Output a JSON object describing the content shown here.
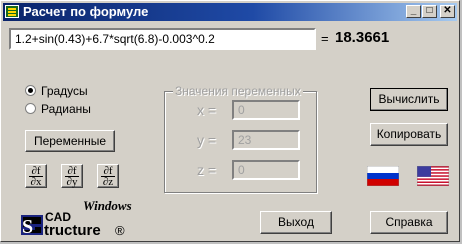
{
  "window": {
    "title": "Расчет по формуле",
    "min_label": "_",
    "max_label": "□",
    "close_label": "✕"
  },
  "formula": {
    "expression": "1.2+sin(0.43)+6.7*sqrt(6.8)-0.003^0.2",
    "equals": "=",
    "result": "18.3661"
  },
  "angle_units": {
    "options": [
      "Градусы",
      "Радианы"
    ],
    "selected": "Градусы"
  },
  "variables_group": {
    "title": "Значения переменных",
    "vars": [
      {
        "label": "x =",
        "value": "0"
      },
      {
        "label": "y =",
        "value": "23"
      },
      {
        "label": "z =",
        "value": "0"
      }
    ]
  },
  "buttons": {
    "variables": "Переменные",
    "calculate": "Вычислить",
    "copy": "Копировать",
    "exit": "Выход",
    "help": "Справка"
  },
  "derivatives": [
    {
      "num": "∂f",
      "den": "∂x"
    },
    {
      "num": "∂f",
      "den": "∂y"
    },
    {
      "num": "∂f",
      "den": "∂z"
    }
  ],
  "language_flags": [
    "russian-flag",
    "us-flag"
  ],
  "logo": {
    "top": "Windows",
    "cad": "CAD",
    "main": "tructure",
    "initial": "S",
    "mark": "®"
  }
}
